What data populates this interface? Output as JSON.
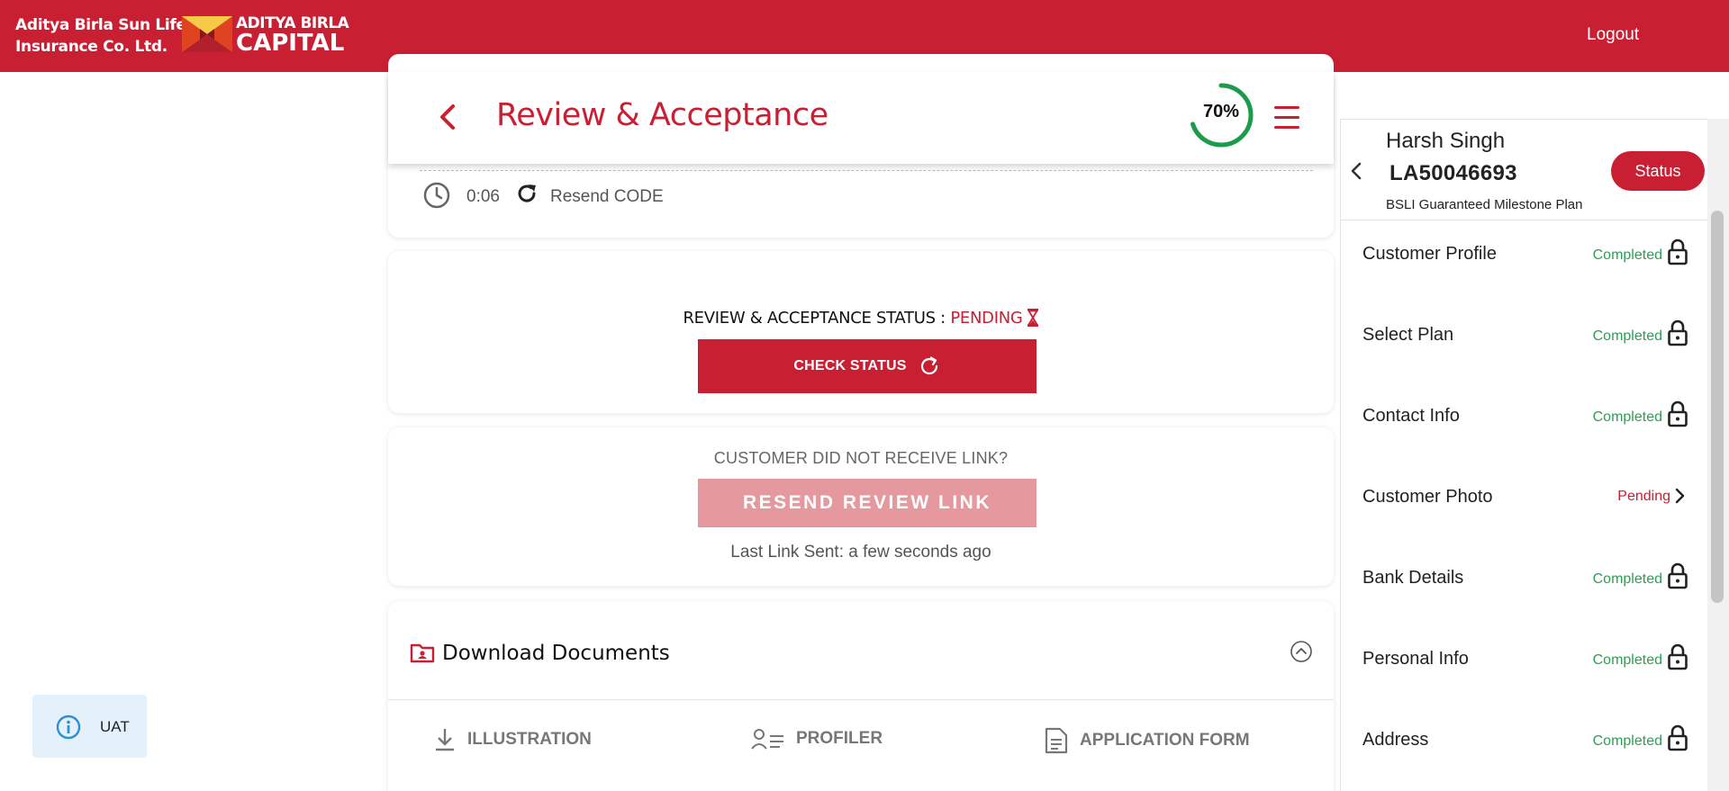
{
  "header": {
    "company_line1": "Aditya Birla Sun Life",
    "company_line2": "Insurance Co. Ltd.",
    "logo_line1": "ADITYA BIRLA",
    "logo_line2": "CAPITAL",
    "logout_label": "Logout"
  },
  "title_bar": {
    "title": "Review & Acceptance",
    "progress_text": "70%",
    "progress_value": 0.7
  },
  "otp": {
    "timer": "0:06",
    "resend_code_label": "Resend CODE"
  },
  "review_status": {
    "label": "REVIEW & ACCEPTANCE STATUS : ",
    "value": "PENDING",
    "check_button": "CHECK STATUS"
  },
  "resend_link": {
    "prompt": "CUSTOMER DID NOT RECEIVE LINK?",
    "button": "RESEND REVIEW LINK",
    "last_sent": "Last Link Sent: a few seconds ago"
  },
  "documents": {
    "title": "Download Documents",
    "links": [
      {
        "label": "ILLUSTRATION",
        "icon": "download-icon"
      },
      {
        "label": "PROFILER",
        "icon": "profile-list-icon"
      },
      {
        "label": "APPLICATION FORM",
        "icon": "document-icon"
      }
    ]
  },
  "env_badge": {
    "label": "UAT",
    "icon": "info-icon"
  },
  "side_panel": {
    "customer_name": "Harsh Singh",
    "application_id": "LA50046693",
    "plan_name": "BSLI Guaranteed Milestone Plan",
    "status_button": "Status",
    "steps": [
      {
        "label": "Customer Profile",
        "status": "Completed",
        "icon": "lock-icon"
      },
      {
        "label": "Select Plan",
        "status": "Completed",
        "icon": "lock-icon"
      },
      {
        "label": "Contact Info",
        "status": "Completed",
        "icon": "lock-icon"
      },
      {
        "label": "Customer Photo",
        "status": "Pending",
        "icon": "chevron-right-icon"
      },
      {
        "label": "Bank Details",
        "status": "Completed",
        "icon": "lock-icon"
      },
      {
        "label": "Personal Info",
        "status": "Completed",
        "icon": "lock-icon"
      },
      {
        "label": "Address",
        "status": "Completed",
        "icon": "lock-icon"
      }
    ]
  },
  "colors": {
    "brand_red": "#c91f33",
    "completed_green": "#2e9e53",
    "progress_green": "#1e9a4d",
    "disabled_button": "#e5999f"
  }
}
